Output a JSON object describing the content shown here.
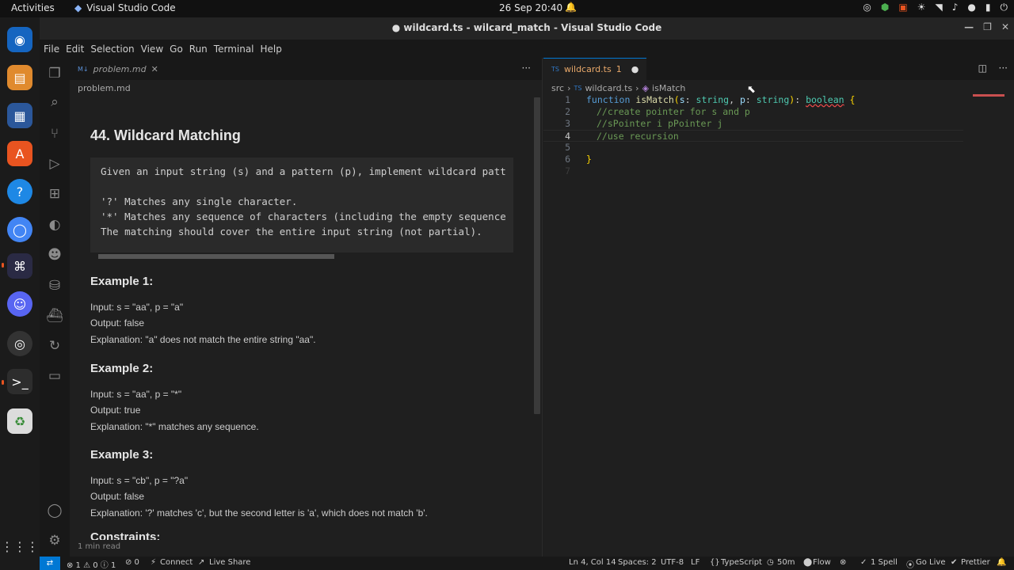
{
  "topbar": {
    "activities": "Activities",
    "app": "Visual Studio Code",
    "clock": "26 Sep  20:40"
  },
  "window": {
    "title": "● wildcard.ts - wilcard_match - Visual Studio Code"
  },
  "menu": [
    "File",
    "Edit",
    "Selection",
    "View",
    "Go",
    "Run",
    "Terminal",
    "Help"
  ],
  "left": {
    "tab_label": "problem.md",
    "tab_icon": "M↓",
    "breadcrumb": "problem.md",
    "title": "44. Wildcard Matching",
    "code_lines": [
      "Given an input string (s) and a pattern (p), implement wildcard patt",
      "",
      "'?' Matches any single character.",
      "'*' Matches any sequence of characters (including the empty sequence",
      "The matching should cover the entire input string (not partial)."
    ],
    "ex1": {
      "h": "Example 1:",
      "l1": "Input: s = \"aa\", p = \"a\"",
      "l2": "Output: false",
      "l3": "Explanation: \"a\" does not match the entire string \"aa\"."
    },
    "ex2": {
      "h": "Example 2:",
      "l1": "Input: s = \"aa\", p = \"*\"",
      "l2": "Output: true",
      "l3": "Explanation: \"*\" matches any sequence."
    },
    "ex3": {
      "h": "Example 3:",
      "l1": "Input: s = \"cb\", p = \"?a\"",
      "l2": "Output: false",
      "l3": "Explanation: '?' matches 'c', but the second letter is 'a', which does not match 'b'."
    },
    "constraints": "Constraints:",
    "read_time": "1 min read",
    "more_icon": "···"
  },
  "right": {
    "tab_label": "wildcard.ts",
    "tab_badge": "1",
    "tab_lang": "TS",
    "breadcrumb": {
      "src": "src",
      "file": "wildcard.ts",
      "symbol": "isMatch"
    },
    "lines": [
      "1",
      "2",
      "3",
      "4",
      "5",
      "6",
      "7"
    ],
    "code": {
      "l1_kw": "function",
      "l1_fn": "isMatch",
      "l1_p1": "s",
      "l1_t1": "string",
      "l1_p2": "p",
      "l1_t2": "string",
      "l1_ret": "boolean",
      "l2": "//create pointer for s and p",
      "l3": "//sPointer i pPointer j",
      "l4": "//use recursion",
      "l6": "}"
    }
  },
  "status": {
    "errors": "⊗ 1 ⚠ 0 ⓘ 1",
    "ports": "⊘ 0",
    "connect": "Connect",
    "liveshare": "Live Share",
    "pos": "Ln 4, Col 14",
    "spaces": "Spaces: 2",
    "enc": "UTF-8",
    "eol": "LF",
    "lang": "TypeScript",
    "time": "50m",
    "flow": "Flow",
    "spell": "1 Spell",
    "golive": "Go Live",
    "prettier": "Prettier"
  }
}
